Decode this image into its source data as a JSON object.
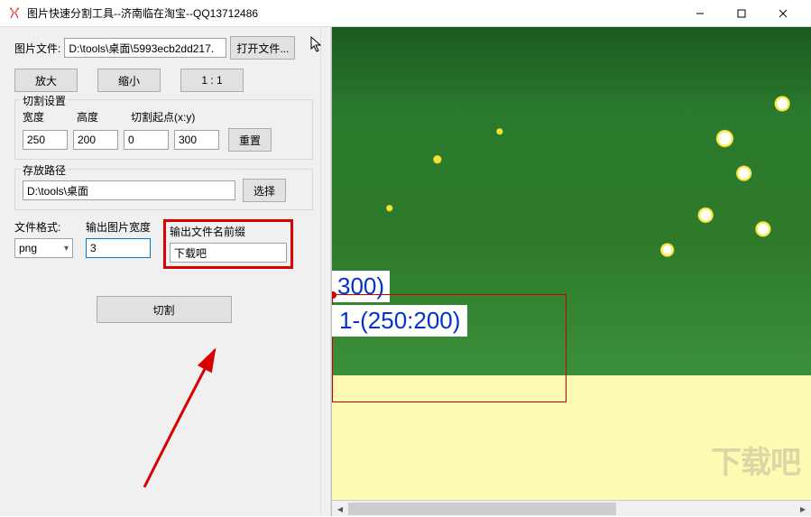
{
  "title": "图片快速分割工具--济南临在淘宝--QQ13712486",
  "left": {
    "file_label": "图片文件:",
    "file_value": "D:\\tools\\桌面\\5993ecb2dd217.",
    "open_btn": "打开文件...",
    "zoom_in": "放大",
    "zoom_out": "缩小",
    "zoom_11": "1 : 1",
    "cut_settings_legend": "切割设置",
    "width_label": "宽度",
    "height_label": "高度",
    "origin_label": "切割起点(x:y)",
    "width_value": "250",
    "height_value": "200",
    "origin_x_value": "0",
    "origin_y_value": "300",
    "reset_btn": "重置",
    "save_legend": "存放路径",
    "save_path": "D:\\tools\\桌面",
    "choose_btn": "选择",
    "format_label": "文件格式:",
    "format_value": "png",
    "out_width_label": "输出图片宽度",
    "out_width_value": "3",
    "out_prefix_label": "输出文件名前缀",
    "out_prefix_value": "下载吧",
    "cut_btn": "切割"
  },
  "viewer": {
    "overlay_partial": "300)",
    "overlay_tile": "1-(250:200)",
    "watermark": "下载吧"
  }
}
